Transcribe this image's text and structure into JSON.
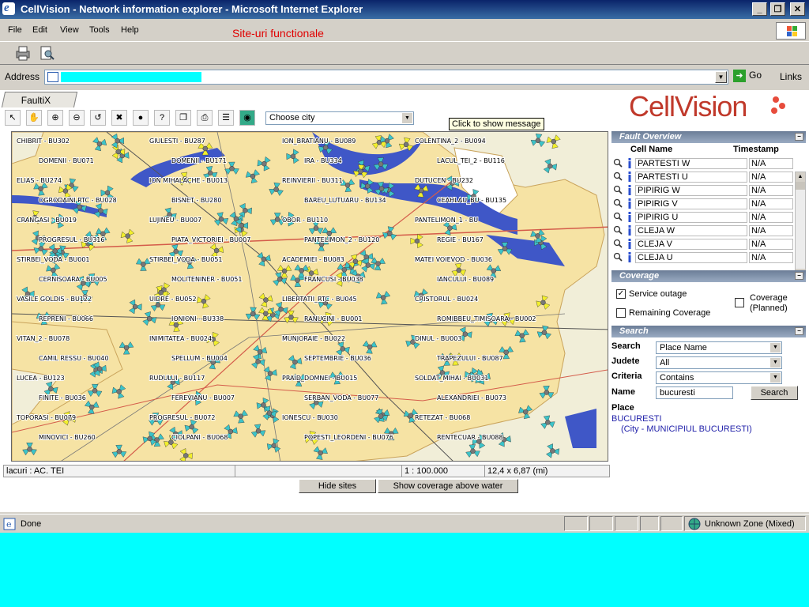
{
  "window": {
    "title": "CellVision - Network information explorer - Microsoft Internet Explorer",
    "min_label": "_",
    "max_label": "❐",
    "close_label": "✕"
  },
  "menu": {
    "items": [
      "File",
      "Edit",
      "View",
      "Tools",
      "Help"
    ],
    "message": "Site-uri functionale"
  },
  "address": {
    "label": "Address",
    "go_label": "Go",
    "links_label": "Links"
  },
  "app": {
    "tab_label": "FaultiX",
    "logo_text": "CellVision",
    "city_select": "Choose city",
    "tooltip": "Click to show message"
  },
  "map": {
    "status_left": "lacuri : AC. TEI",
    "scale": "1 : 100.000",
    "extent": "12,4 x 6,87 (mi)",
    "hide_sites_label": "Hide sites",
    "coverage_label": "Show coverage above water",
    "labels": [
      "CHIBRIT - BU302",
      "GIULESTI - BU287",
      "ION_BRATIANU - BU089",
      "COLENTINA_2 - BU094",
      "DOMENII - BU071",
      "DOMENII - BU171",
      "IRA - BU334",
      "LACUL_TEI_2 - BU116",
      "ELIAS - BU274",
      "ION MIHALACHE - BU013",
      "REINVIERII - BU311",
      "DUTUCEN - BU232",
      "OGRODAINI RTC - BU028",
      "BISNET - BU280",
      "BAREU_LUTUARU - BU134",
      "CEAHLAU_BU - BU135",
      "CRANGASI - BU019",
      "LUJINEU - BU007",
      "OBOR - BU110",
      "PANTELIMON_1 - BU",
      "PROGRESUL - BU316",
      "PIATA_VICTORIEI - BU007",
      "PANTELIMON_2 - BU120",
      "REGIE - BU167",
      "STIRBEI_VODA - BU001",
      "STIRBEI_VODA - BU051",
      "ACADEMIEI - BU083",
      "MATEI VOIEVOD - BU036",
      "CERNISOARA - BU005",
      "MOLITENINER - BU051",
      "FRANCUSI - BU038",
      "IANCULUI - BU089",
      "VASILE GOLDIS - BU122",
      "UIDRE - BU052",
      "LIBERTATII_RTC - BU045",
      "CRISTORUL - BU024",
      "REPRENI - BU066",
      "IONIONI - BU338",
      "RANUCINI - BU001",
      "ROMIBBEU_TIMISOARA - BU002",
      "VITAN_2 - BU078",
      "INIMITATEA - BU024",
      "MUNJORAIE - BU022",
      "DINUL - BU003",
      "CAMIL RESSU - BU040",
      "SPELLUM - BU004",
      "SEPTEMBRIE - BU036",
      "TRAPEZULUI - BU087",
      "LUCEA - BU123",
      "RUDULUI - BU117",
      "PRAID_DOMNEI - BU015",
      "SOLDAT_MIHAI - BU031",
      "FINITE - BU036",
      "FEREVIANU - BU007",
      "SERBAN_VODA - BU077",
      "ALEXANDRIEI - BU073",
      "TOPORASI - BU079",
      "PROGRESUL - BU072",
      "IONESCU - BU030",
      "RETEZAT - BU068",
      "MINOVICI - BU260",
      "CIOLPANI - BU068",
      "POPESTI_LEORDENI - BU076",
      "RENTECUAR - BU088"
    ]
  },
  "fault_overview": {
    "title": "Fault Overview",
    "col_name": "Cell Name",
    "col_ts": "Timestamp",
    "rows": [
      {
        "name": "PARTESTI W",
        "ts": "N/A"
      },
      {
        "name": "PARTESTI U",
        "ts": "N/A"
      },
      {
        "name": "PIPIRIG W",
        "ts": "N/A"
      },
      {
        "name": "PIPIRIG V",
        "ts": "N/A"
      },
      {
        "name": "PIPIRIG U",
        "ts": "N/A"
      },
      {
        "name": "CLEJA W",
        "ts": "N/A"
      },
      {
        "name": "CLEJA V",
        "ts": "N/A"
      },
      {
        "name": "CLEJA U",
        "ts": "N/A"
      }
    ]
  },
  "coverage": {
    "title": "Coverage",
    "service_outage": "Service outage",
    "remaining": "Remaining Coverage",
    "planned_line1": "Coverage",
    "planned_line2": "(Planned)",
    "check_mark": "✓"
  },
  "search": {
    "title": "Search",
    "search_label": "Search",
    "search_value": "Place Name",
    "judete_label": "Judete",
    "judete_value": "All",
    "criteria_label": "Criteria",
    "criteria_value": "Contains",
    "name_label": "Name",
    "name_value": "bucuresti",
    "button_label": "Search",
    "place_label": "Place",
    "result_name": "BUCURESTI",
    "result_detail": "(City - MUNICIPIUL BUCURESTI)"
  },
  "status": {
    "done": "Done",
    "zone": "Unknown Zone (Mixed)"
  },
  "colors": {
    "map_city": "#f6e3a4",
    "map_water": "#3f57c7",
    "site_cyan": "#3cc3c8",
    "site_yellow": "#f2ef2c",
    "road_red": "#d45b4a"
  }
}
